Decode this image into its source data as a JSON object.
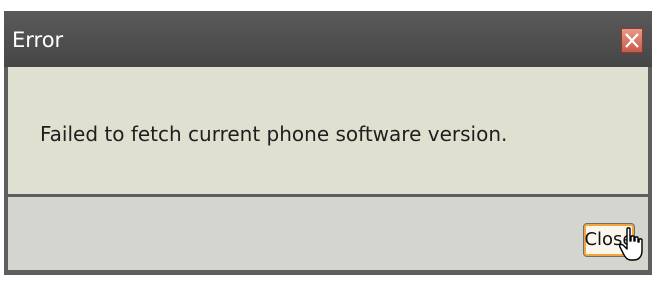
{
  "dialog": {
    "title": "Error",
    "message": "Failed to fetch current phone software version.",
    "close_button_label": "Close"
  },
  "icons": {
    "title_close": "close-icon",
    "pointer": "hand-pointer-icon"
  },
  "colors": {
    "title_bar": "#4f4f4f",
    "title_close_button": "#d3705e",
    "message_background": "#e0e0d1",
    "footer_background": "#d5d5cf",
    "button_focus_ring": "#f2a53a"
  }
}
